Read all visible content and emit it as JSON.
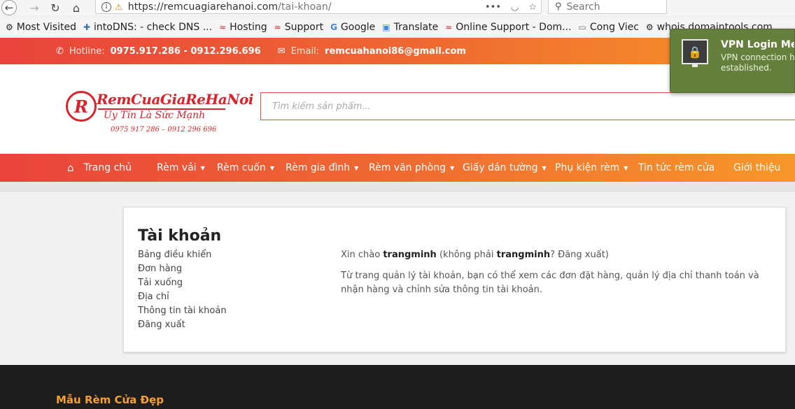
{
  "browser": {
    "url_host": "https://remcuagiarehanoi.com",
    "url_path": "/tai-khoan/",
    "search_placeholder": "Search",
    "bookmarks": [
      {
        "label": "Most Visited",
        "icon": "gear-icon"
      },
      {
        "label": "intoDNS: - check DNS ...",
        "icon": "puzzle-icon"
      },
      {
        "label": "Hosting",
        "icon": "brand-icon"
      },
      {
        "label": "Support",
        "icon": "brand-icon"
      },
      {
        "label": "Google",
        "icon": "google-icon"
      },
      {
        "label": "Translate",
        "icon": "translate-icon"
      },
      {
        "label": "Online Support - Dom...",
        "icon": "brand-icon"
      },
      {
        "label": "Cong Viec",
        "icon": "folder-icon"
      },
      {
        "label": "whois.domaintools.com",
        "icon": "gear-icon"
      }
    ]
  },
  "topbar": {
    "hotline_label": "Hotline:",
    "hotline_value": "0975.917.286 - 0912.296.696",
    "email_label": "Email:",
    "email_value": "remcuahanoi86@gmail.com"
  },
  "header": {
    "logo_mark": "R",
    "logo_brand": "RemCuaGiaReHaNoi",
    "logo_slogan": "Uy Tín Là Sức Mạnh",
    "logo_phones": "0975 917 286 – 0912 296 696",
    "search_placeholder": "Tìm kiếm sản phẩm..."
  },
  "nav": {
    "items": [
      {
        "label": "Trang chủ"
      },
      {
        "label": "Rèm vải"
      },
      {
        "label": "Rèm cuốn"
      },
      {
        "label": "Rèm gia đình"
      },
      {
        "label": "Rèm văn phòng"
      },
      {
        "label": "Giấy dán tường"
      },
      {
        "label": "Phụ kiện rèm"
      },
      {
        "label": "Tin tức rèm cửa"
      },
      {
        "label": "Giới thiệu"
      }
    ]
  },
  "account": {
    "title": "Tài khoản",
    "menu": [
      "Bảng điều khiển",
      "Đơn hàng",
      "Tải xuống",
      "Địa chỉ",
      "Thông tin tài khoản",
      "Đăng xuất"
    ],
    "greeting_prefix": "Xin chào",
    "username": "trangminh",
    "greeting_mid": "(không phải",
    "greeting_suffix": "? Đăng xuất)",
    "description": "Từ trang quản lý tài khoản, bạn có thể xem các đơn đặt hàng, quản lý địa chỉ thanh toán và nhận hàng và chỉnh sửa thông tin tài khoản."
  },
  "footer": {
    "title": "Mẫu Rèm Cửa Đẹp"
  },
  "vpn_notification": {
    "title": "VPN Login Mes",
    "message_line1": "VPN connection h",
    "message_line2": "established."
  }
}
